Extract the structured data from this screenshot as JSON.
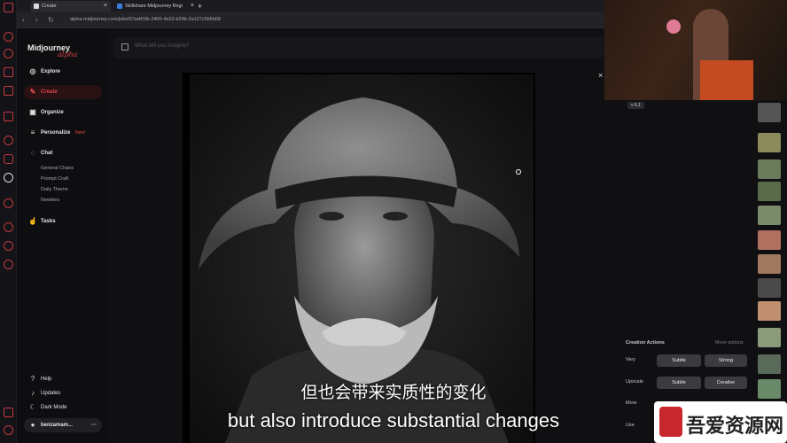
{
  "browser": {
    "tabs": [
      {
        "label": "Create"
      },
      {
        "label": "Skillshare Midjourney Begi"
      }
    ],
    "url": "alpha.midjourney.com/jobs/07ad41fb-2400-4e23-b24b-2a127c5b5b68"
  },
  "sidebar": {
    "logo": "Midjourney",
    "logo_sub": "alpha",
    "items": [
      {
        "label": "Explore",
        "icon": "compass-icon"
      },
      {
        "label": "Create",
        "icon": "brush-icon"
      },
      {
        "label": "Organize",
        "icon": "folder-icon"
      },
      {
        "label": "Personalize",
        "icon": "sliders-icon",
        "badge": "New!"
      },
      {
        "label": "Chat",
        "icon": "chat-icon"
      },
      {
        "label": "Tasks",
        "icon": "thumbs-up-icon"
      }
    ],
    "chat_rooms": [
      "General Chaos",
      "Prompt Craft",
      "Daily Theme",
      "Newbies"
    ],
    "footer": [
      {
        "label": "Help"
      },
      {
        "label": "Updates"
      },
      {
        "label": "Dark Mode"
      }
    ],
    "user": "benzamam..."
  },
  "search": {
    "placeholder": "What will you imagine?"
  },
  "version_badge": "v 6.1",
  "actions": {
    "title": "Creation Actions",
    "more": "More options",
    "rows": [
      {
        "label": "Vary",
        "buttons": [
          "Subtle",
          "Strong"
        ]
      },
      {
        "label": "Upscale",
        "buttons": [
          "Subtle",
          "Creative"
        ]
      },
      {
        "label": "More",
        "buttons": []
      },
      {
        "label": "Use",
        "buttons": []
      }
    ]
  },
  "subtitles": {
    "zh": "但也会带来实质性的变化",
    "en": "but also introduce substantial changes"
  },
  "watermark": "吾爱资源网",
  "colors": {
    "accent": "#e0464a",
    "sidebar_bg": "#0e0e11"
  }
}
